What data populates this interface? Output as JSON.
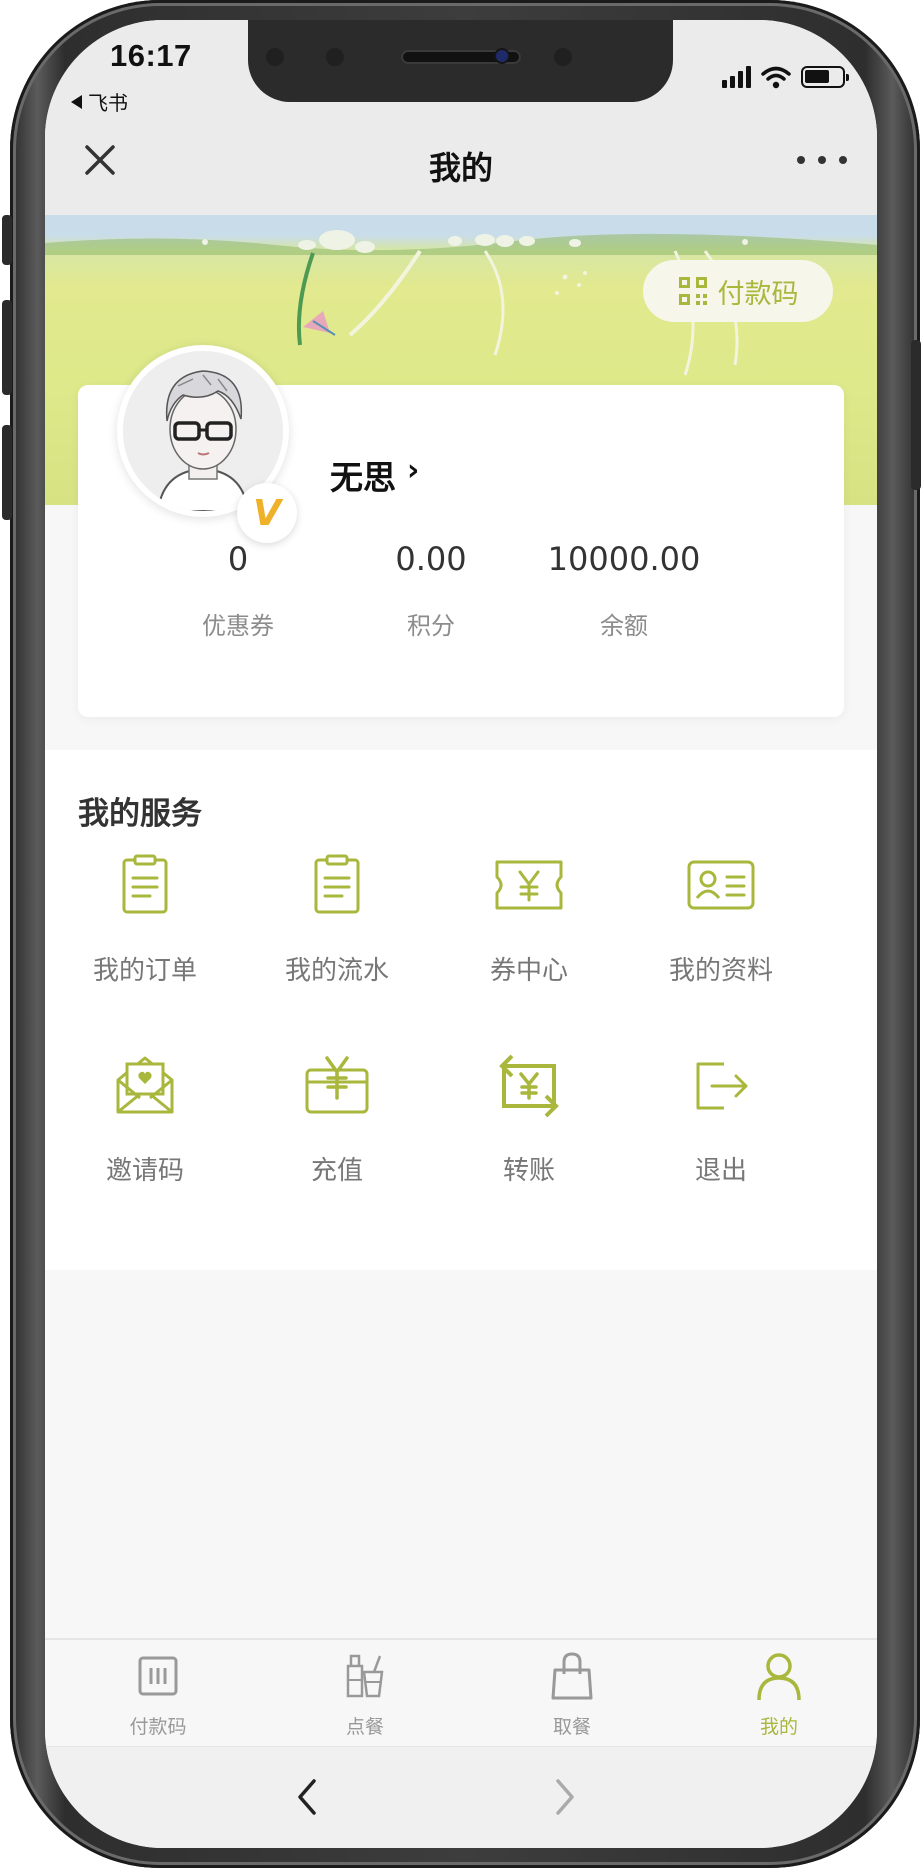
{
  "status_bar": {
    "time": "16:17",
    "back_app": "飞书"
  },
  "nav": {
    "title": "我的"
  },
  "banner": {
    "pay_code_label": "付款码"
  },
  "profile": {
    "username": "无思",
    "username_arrow": "›",
    "vip_badge": "V",
    "stats": [
      {
        "value": "0",
        "label": "优惠券"
      },
      {
        "value": "0.00",
        "label": "积分"
      },
      {
        "value": "10000.00",
        "label": "余额"
      }
    ]
  },
  "services": {
    "title": "我的服务",
    "items": [
      {
        "label": "我的订单",
        "icon": "clipboard-icon"
      },
      {
        "label": "我的流水",
        "icon": "clipboard-icon"
      },
      {
        "label": "券中心",
        "icon": "coupon-icon"
      },
      {
        "label": "我的资料",
        "icon": "id-card-icon"
      },
      {
        "label": "邀请码",
        "icon": "invite-envelope-icon"
      },
      {
        "label": "充值",
        "icon": "recharge-icon"
      },
      {
        "label": "转账",
        "icon": "transfer-icon"
      },
      {
        "label": "退出",
        "icon": "logout-icon"
      }
    ]
  },
  "tabbar": {
    "tabs": [
      {
        "label": "付款码",
        "icon": "pay-code-icon",
        "active": false
      },
      {
        "label": "点餐",
        "icon": "drinks-icon",
        "active": false
      },
      {
        "label": "取餐",
        "icon": "bag-icon",
        "active": false
      },
      {
        "label": "我的",
        "icon": "user-icon",
        "active": true
      }
    ]
  },
  "colors": {
    "accent": "#a9b73d",
    "vip": "#f0b12a",
    "text_primary": "#111111",
    "text_secondary": "#8c8c8c"
  }
}
